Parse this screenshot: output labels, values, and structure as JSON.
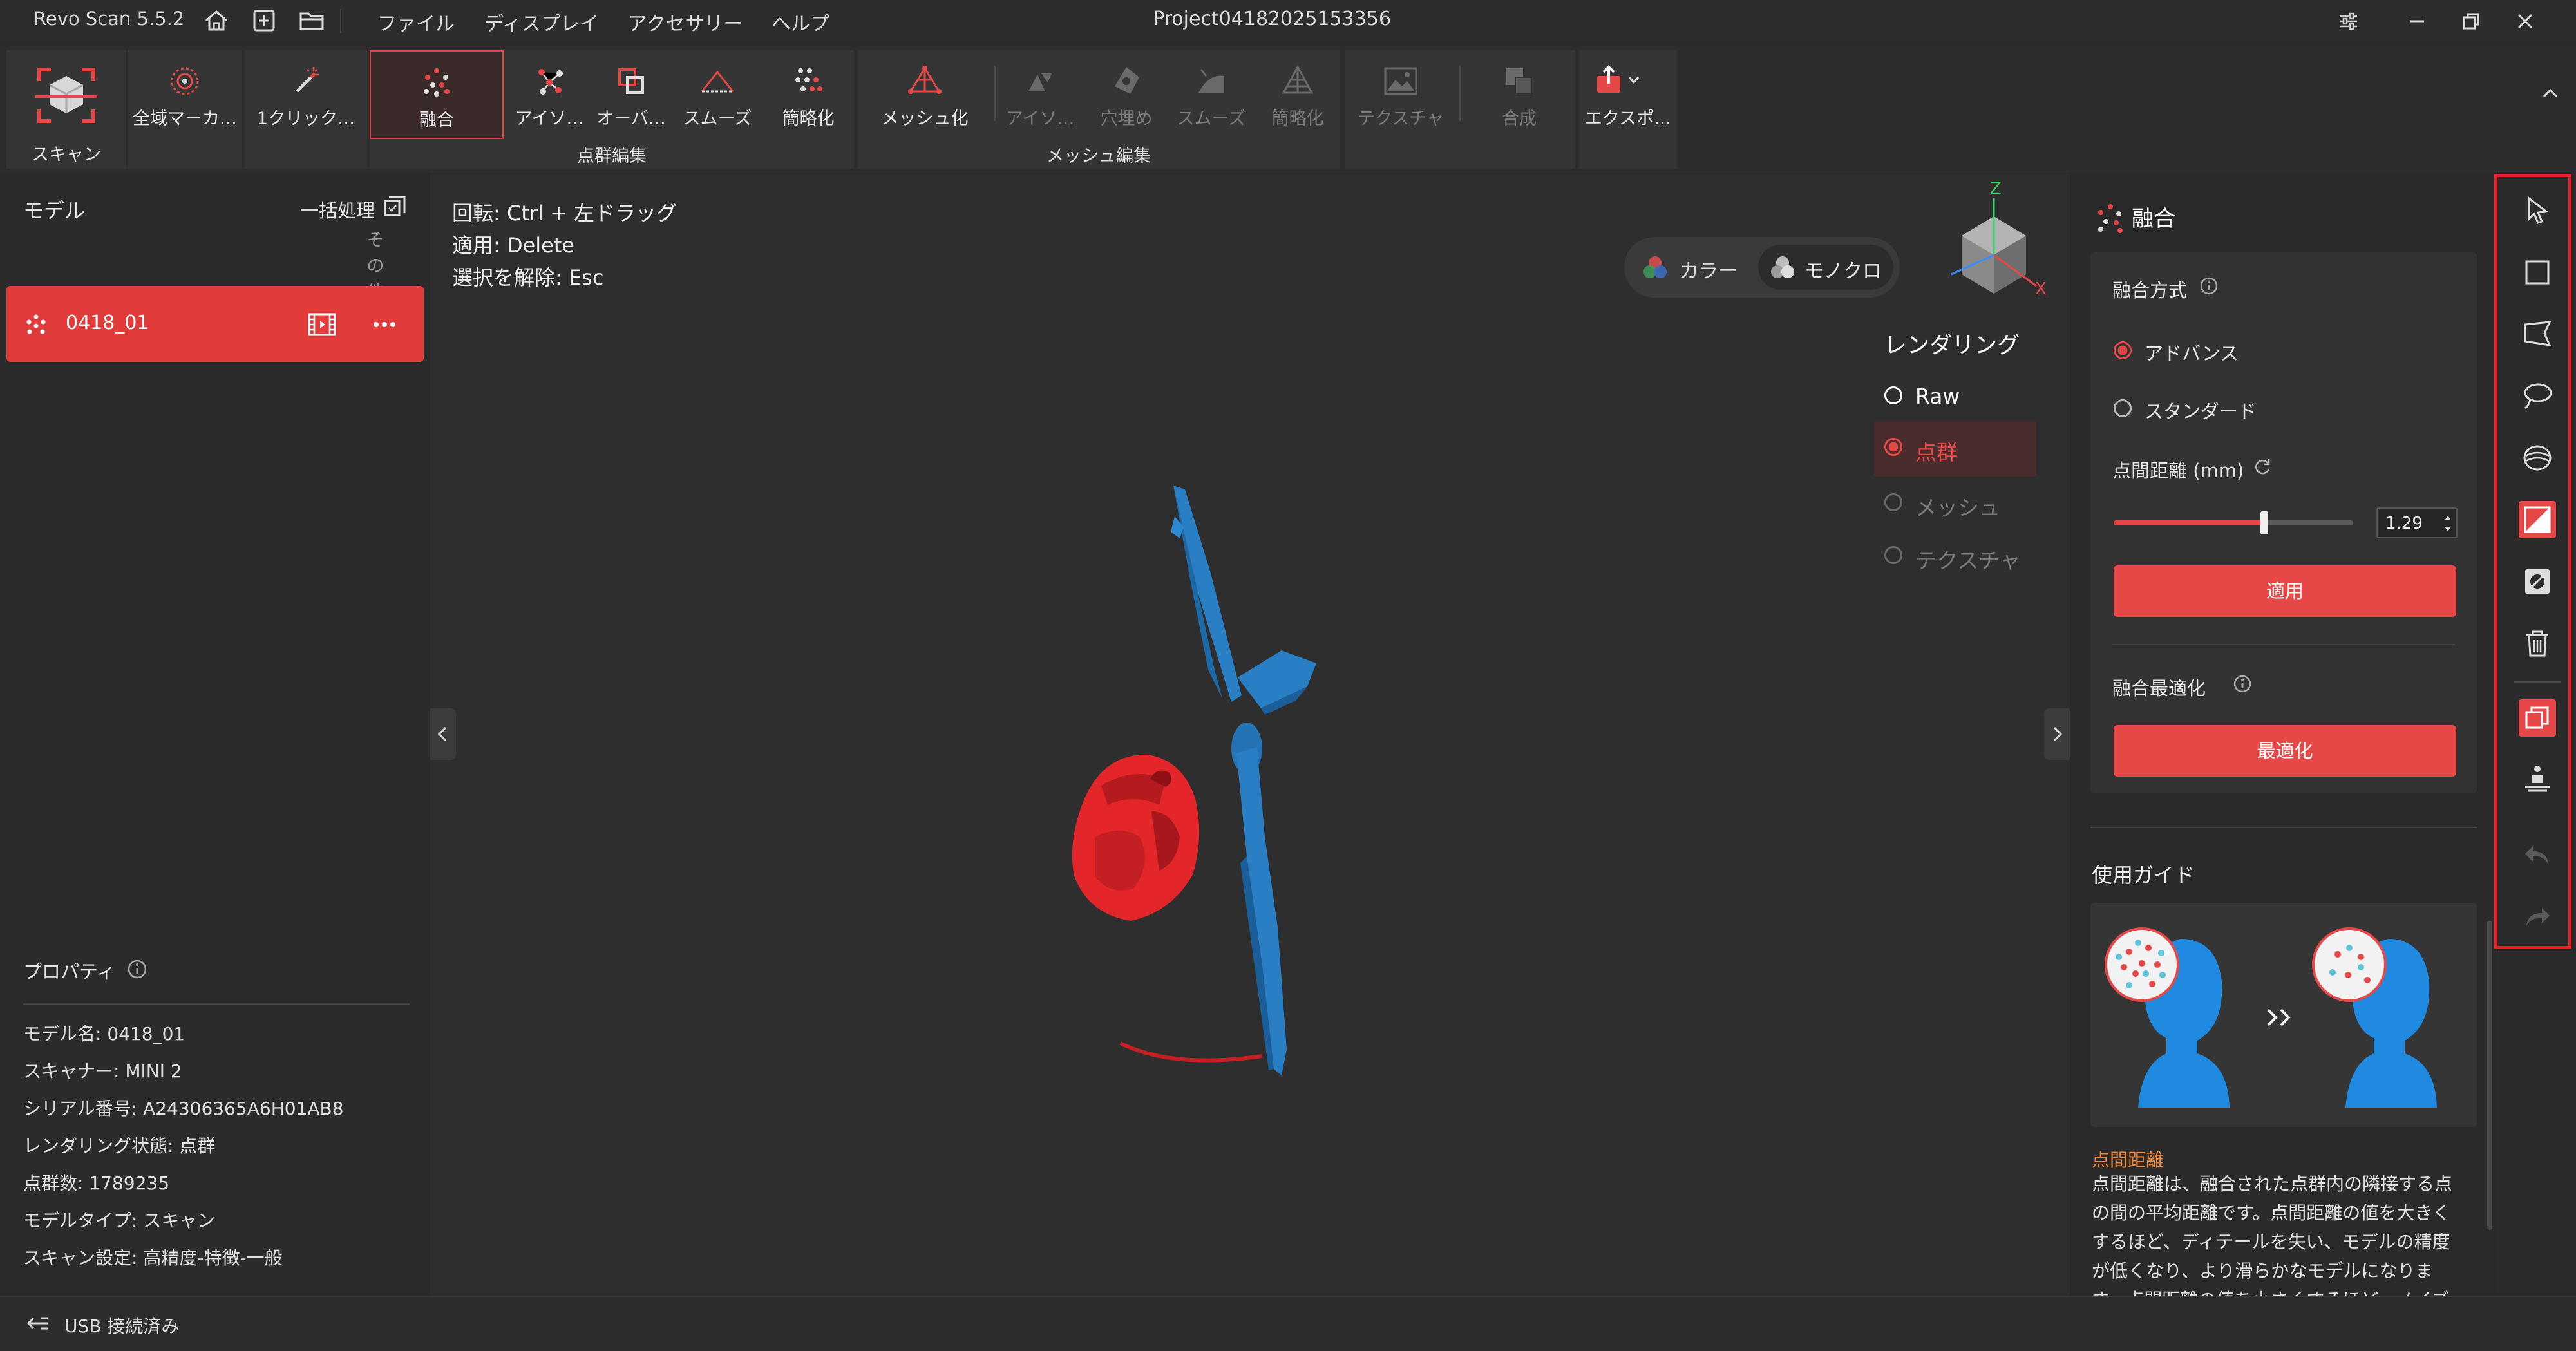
{
  "app": {
    "name": "Revo Scan 5.5.2",
    "project_title": "Project04182025153356"
  },
  "menu": [
    "ファイル",
    "ディスプレイ",
    "アクセサリー",
    "ヘルプ"
  ],
  "toolbar": {
    "scan": "スキャン",
    "global_marker": "全域マーカ…",
    "one_click": "1クリック…",
    "fusion": "融合",
    "isolate": "アイソ…",
    "overlap": "オーバ…",
    "smooth": "スムーズ",
    "simplify": "簡略化",
    "pointcloud_group": "点群編集",
    "meshing": "メッシュ化",
    "mesh_isolate": "アイソ…",
    "fill_holes": "穴埋め",
    "mesh_smooth": "スムーズ",
    "mesh_simplify": "簡略化",
    "mesh_group": "メッシュ編集",
    "texture": "テクスチャ",
    "merge": "合成",
    "export": "エクスポ…"
  },
  "left": {
    "title": "モデル",
    "batch": "一括処理",
    "other": "その他",
    "model_name": "0418_01",
    "properties_title": "プロパティ",
    "properties": [
      "モデル名:  0418_01",
      "スキャナー:  MINI 2",
      "シリアル番号:  A24306365A6H01AB8",
      "レンダリング状態:  点群",
      "点群数:  1789235",
      "モデルタイプ:  スキャン",
      "スキャン設定:  高精度-特徴-一般"
    ]
  },
  "viewport": {
    "hints": [
      "回転: Ctrl + 左ドラッグ",
      "適用: Delete",
      "選択を解除: Esc"
    ],
    "color_toggle": "カラー",
    "mono_toggle": "モノクロ",
    "rendering_title": "レンダリング",
    "render_options": [
      "Raw",
      "点群",
      "メッシュ",
      "テクスチャ"
    ],
    "render_selected": "点群",
    "axis_z": "Z",
    "axis_x": "X",
    "colors": {
      "blue_model": "#2a7fc4",
      "red_model": "#e3262a"
    }
  },
  "right": {
    "title": "融合",
    "fusion_mode_label": "融合方式",
    "mode_advanced": "アドバンス",
    "mode_standard": "スタンダード",
    "point_distance_label": "点間距離 (mm)",
    "point_distance_value": "1.29",
    "slider_fraction": 0.63,
    "apply_button": "適用",
    "optimize_label": "融合最適化",
    "optimize_button": "最適化",
    "guide_title": "使用ガイド",
    "guide_subtitle": "点間距離",
    "guide_text": "点間距離は、融合された点群内の隣接する点の間の平均距離です。点間距離の値を大きくするほど、ディテールを失い、モデルの精度が低くなり、より滑らかなモデルになります。点間距離の値を小さくするほど、ノイズ"
  },
  "status": {
    "connection": "USB 接続済み"
  },
  "theme": {
    "accent": "#e64848",
    "strip_highlight": "#e8202a"
  }
}
